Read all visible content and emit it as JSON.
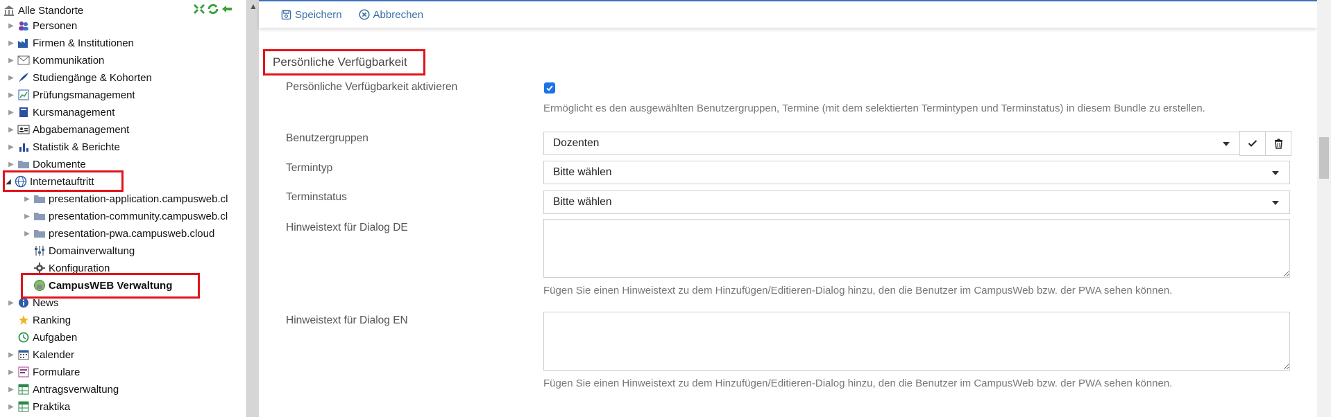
{
  "sidebar": {
    "root_label": "Alle Standorte",
    "items": [
      {
        "label": "Personen",
        "icon": "people-icon"
      },
      {
        "label": "Firmen & Institutionen",
        "icon": "factory-icon"
      },
      {
        "label": "Kommunikation",
        "icon": "envelope-icon"
      },
      {
        "label": "Studiengänge & Kohorten",
        "icon": "quill-icon"
      },
      {
        "label": "Prüfungsmanagement",
        "icon": "exam-chart-icon"
      },
      {
        "label": "Kursmanagement",
        "icon": "book-icon"
      },
      {
        "label": "Abgabemanagement",
        "icon": "id-card-icon"
      },
      {
        "label": "Statistik & Berichte",
        "icon": "bar-chart-icon"
      },
      {
        "label": "Dokumente",
        "icon": "folder-icon"
      },
      {
        "label": "Internetauftritt",
        "icon": "globe-icon"
      },
      {
        "label": "presentation-application.campusweb.cl",
        "icon": "folder-icon"
      },
      {
        "label": "presentation-community.campusweb.cl",
        "icon": "folder-icon"
      },
      {
        "label": "presentation-pwa.campusweb.cloud",
        "icon": "folder-icon"
      },
      {
        "label": "Domainverwaltung",
        "icon": "sliders-icon"
      },
      {
        "label": "Konfiguration",
        "icon": "gear-icon"
      },
      {
        "label": "CampusWEB Verwaltung",
        "icon": "web-admin-icon"
      },
      {
        "label": "News",
        "icon": "info-icon"
      },
      {
        "label": "Ranking",
        "icon": "star-icon"
      },
      {
        "label": "Aufgaben",
        "icon": "history-icon"
      },
      {
        "label": "Kalender",
        "icon": "calendar-icon"
      },
      {
        "label": "Formulare",
        "icon": "form-icon"
      },
      {
        "label": "Antragsverwaltung",
        "icon": "table-icon"
      },
      {
        "label": "Praktika",
        "icon": "table-icon"
      }
    ]
  },
  "toolbar": {
    "save_label": "Speichern",
    "cancel_label": "Abbrechen"
  },
  "form": {
    "section_title": "Persönliche Verfügbarkeit",
    "activate_label": "Persönliche Verfügbarkeit aktivieren",
    "activate_checked": true,
    "activate_hint": "Ermöglicht es den ausgewählten Benutzergruppen, Termine (mit dem selektierten Termintypen und Terminstatus) in diesem Bundle zu erstellen.",
    "usergroups_label": "Benutzergruppen",
    "usergroups_value": "Dozenten",
    "termintyp_label": "Termintyp",
    "termintyp_value": "Bitte wählen",
    "terminstatus_label": "Terminstatus",
    "terminstatus_value": "Bitte wählen",
    "hint_de_label": "Hinweistext für Dialog DE",
    "hint_de_help": "Fügen Sie einen Hinweistext zu dem Hinzufügen/Editieren-Dialog hinzu, den die Benutzer im CampusWeb bzw. der PWA sehen können.",
    "hint_en_label": "Hinweistext für Dialog EN",
    "hint_en_help": "Fügen Sie einen Hinweistext zu dem Hinzufügen/Editieren-Dialog hinzu, den die Benutzer im CampusWeb bzw. der PWA sehen können."
  },
  "colors": {
    "accent": "#1a73e8",
    "highlight_box": "#e0131a",
    "toolbar_link": "#3a6ea5"
  }
}
